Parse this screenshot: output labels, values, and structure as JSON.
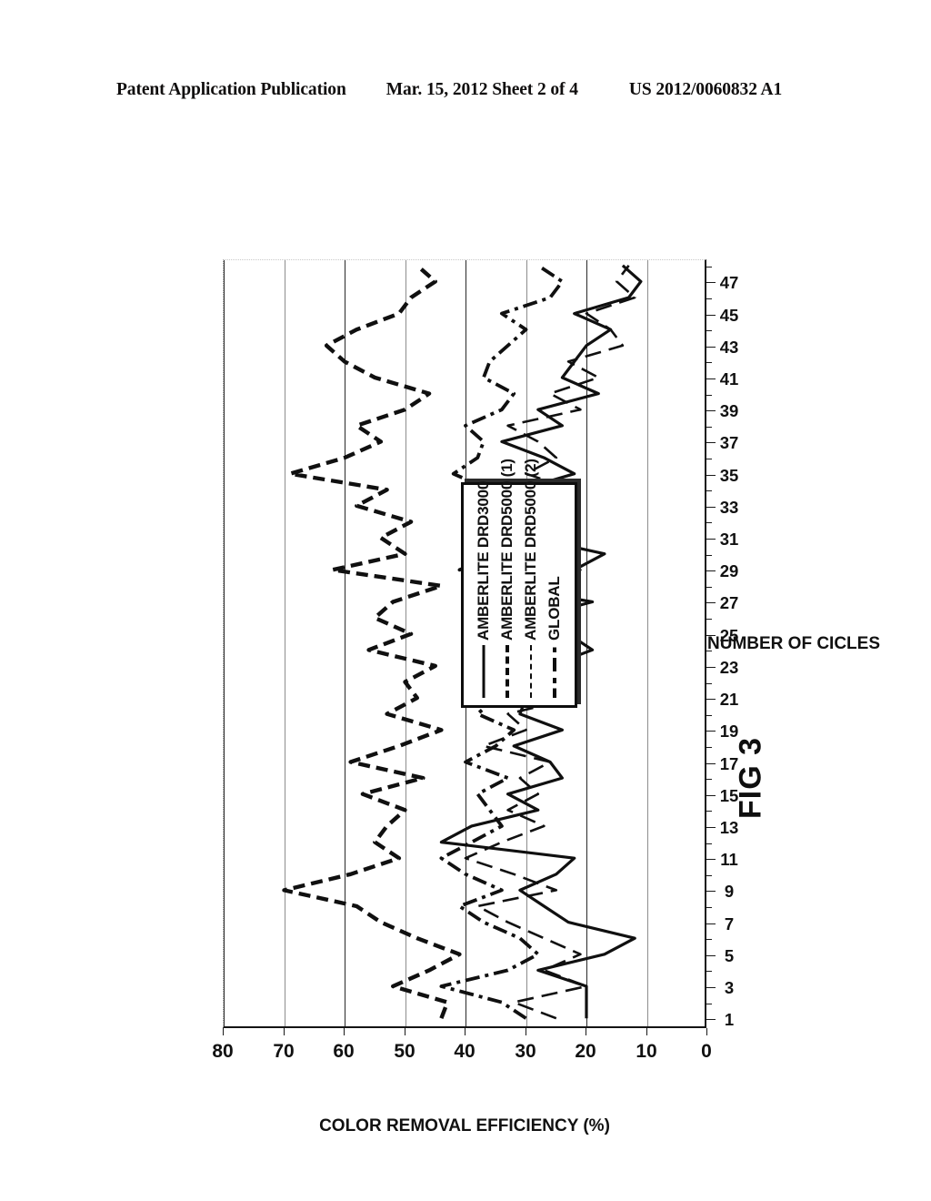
{
  "header": {
    "publication": "Patent Application Publication",
    "date_sheet": "Mar. 15, 2012  Sheet 2 of 4",
    "publication_number": "US 2012/0060832 A1"
  },
  "figure": {
    "caption": "FIG 3"
  },
  "legend": {
    "items": [
      {
        "label": "AMBERLITE DRD3000",
        "style": "solid"
      },
      {
        "label": "AMBERLITE DRD5000 (1)",
        "style": "dash"
      },
      {
        "label": "AMBERLITE DRD5000 (2)",
        "style": "longdash"
      },
      {
        "label": "GLOBAL",
        "style": "dashdot"
      }
    ]
  },
  "chart_data": {
    "type": "line",
    "title": "FIG 3",
    "orientation": "rotated-90-ccw",
    "xlabel": "NUMBER OF CICLES",
    "ylabel": "COLOR REMOVAL EFFICIENCY (%)",
    "ylim": [
      0,
      80
    ],
    "yticks": [
      80,
      70,
      60,
      50,
      40,
      30,
      20,
      10,
      0
    ],
    "grid": true,
    "legend_position": "inside-lower-right",
    "categories": [
      1,
      2,
      3,
      4,
      5,
      6,
      7,
      8,
      9,
      10,
      11,
      12,
      13,
      14,
      15,
      16,
      17,
      18,
      19,
      20,
      21,
      22,
      23,
      24,
      25,
      26,
      27,
      28,
      29,
      30,
      31,
      32,
      33,
      34,
      35,
      36,
      37,
      38,
      39,
      40,
      41,
      42,
      43,
      44,
      45,
      46,
      47,
      48
    ],
    "xticklabels": [
      "1",
      "3",
      "5",
      "7",
      "9",
      "11",
      "13",
      "15",
      "17",
      "19",
      "21",
      "23",
      "25",
      "27",
      "29",
      "31",
      "33",
      "35",
      "37",
      "39",
      "41",
      "43",
      "45",
      "47"
    ],
    "series": [
      {
        "name": "AMBERLITE DRD3000",
        "style": "solid",
        "values": [
          20,
          20,
          20,
          28,
          17,
          12,
          23,
          27,
          31,
          25,
          22,
          44,
          39,
          28,
          33,
          24,
          26,
          32,
          24,
          31,
          30,
          23,
          26,
          19,
          23,
          29,
          19,
          34,
          22,
          17,
          29,
          26,
          27,
          31,
          22,
          27,
          34,
          24,
          28,
          18,
          24,
          22,
          20,
          16,
          22,
          13,
          11,
          14
        ]
      },
      {
        "name": "AMBERLITE DRD5000 (1)",
        "style": "dash",
        "values": [
          44,
          43,
          52,
          46,
          41,
          48,
          54,
          58,
          70,
          59,
          51,
          55,
          53,
          50,
          57,
          47,
          59,
          51,
          44,
          53,
          48,
          50,
          45,
          56,
          49,
          55,
          52,
          44,
          62,
          50,
          54,
          49,
          58,
          53,
          69,
          60,
          54,
          58,
          50,
          46,
          55,
          60,
          63,
          58,
          51,
          49,
          45,
          48
        ]
      },
      {
        "name": "AMBERLITE DRD5000 (2)",
        "style": "longdash",
        "values": [
          25,
          32,
          20,
          27,
          21,
          27,
          33,
          38,
          25,
          32,
          40,
          34,
          27,
          33,
          28,
          31,
          26,
          37,
          30,
          33,
          22,
          26,
          24,
          30,
          31,
          26,
          33,
          27,
          21,
          28,
          25,
          34,
          29,
          22,
          30,
          25,
          28,
          33,
          21,
          26,
          18,
          23,
          14,
          16,
          20,
          12,
          15,
          13
        ]
      },
      {
        "name": "GLOBAL",
        "style": "dashdot",
        "values": [
          30,
          34,
          44,
          33,
          28,
          31,
          37,
          41,
          34,
          40,
          44,
          39,
          34,
          36,
          38,
          33,
          40,
          35,
          32,
          38,
          35,
          36,
          31,
          39,
          35,
          40,
          36,
          33,
          41,
          34,
          37,
          35,
          40,
          36,
          42,
          38,
          37,
          40,
          34,
          32,
          37,
          36,
          33,
          30,
          34,
          26,
          24,
          28
        ]
      }
    ]
  }
}
